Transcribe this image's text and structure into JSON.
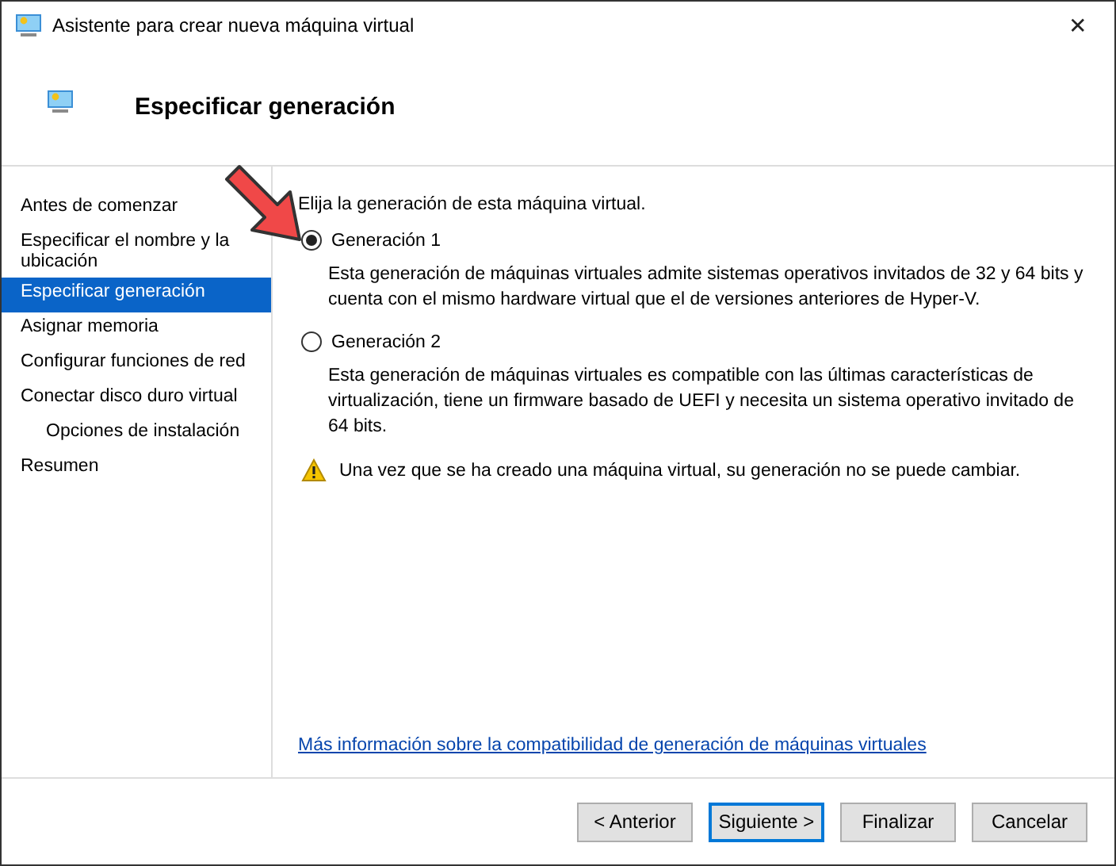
{
  "window": {
    "title": "Asistente para crear nueva máquina virtual",
    "close": "✕"
  },
  "header": {
    "title": "Especificar generación"
  },
  "sidebar": {
    "items": [
      {
        "label": "Antes de comenzar",
        "selected": false
      },
      {
        "label": "Especificar el nombre y la ubicación",
        "selected": false
      },
      {
        "label": "Especificar generación",
        "selected": true
      },
      {
        "label": "Asignar memoria",
        "selected": false
      },
      {
        "label": "Configurar funciones de red",
        "selected": false
      },
      {
        "label": "Conectar disco duro virtual",
        "selected": false,
        "children": [
          {
            "label": "Opciones de instalación",
            "selected": false
          }
        ]
      },
      {
        "label": "Resumen",
        "selected": false
      }
    ]
  },
  "content": {
    "intro": "Elija la generación de esta máquina virtual.",
    "options": [
      {
        "label": "Generación 1",
        "selected": true,
        "description": "Esta generación de máquinas virtuales admite sistemas operativos invitados de 32 y 64 bits y cuenta con el mismo hardware virtual que el de versiones anteriores de Hyper-V."
      },
      {
        "label": "Generación 2",
        "selected": false,
        "description": "Esta generación de máquinas virtuales es compatible con las últimas características de virtualización, tiene un firmware basado de UEFI y necesita un sistema operativo invitado de 64 bits."
      }
    ],
    "warning": "Una vez que se ha creado una máquina virtual, su generación no se puede cambiar.",
    "link": "Más información sobre la compatibilidad de generación de máquinas virtuales"
  },
  "buttons": [
    {
      "label": "< Anterior",
      "default": false
    },
    {
      "label": "Siguiente >",
      "default": true
    },
    {
      "label": "Finalizar",
      "default": false
    },
    {
      "label": "Cancelar",
      "default": false
    }
  ]
}
